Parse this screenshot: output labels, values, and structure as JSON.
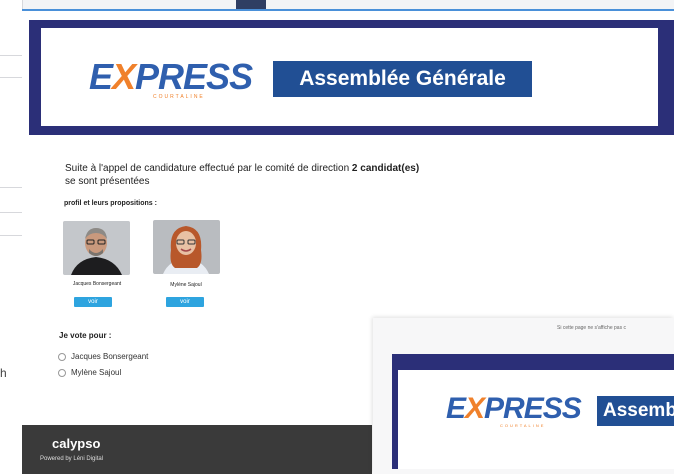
{
  "back_window": {
    "partial_label": "h"
  },
  "email": {
    "logo": {
      "word_pre": "E",
      "word_x": "X",
      "word_post": "PRESS",
      "tagline": "COURTALINE"
    },
    "banner_title": "Assemblée Générale",
    "intro_prefix": "Suite à l'appel de candidature effectué par le comité de direction ",
    "intro_count": "2 candidat(es)",
    "intro_suffix": "se sont présentées",
    "profiles_label": "profil et leurs propositions :",
    "candidates": [
      {
        "name": "Jacques Bonsergeant",
        "button": "voir"
      },
      {
        "name": "Mylène Sajoul",
        "button": "voir"
      }
    ],
    "vote_label": "Je vote pour :",
    "options": [
      "Jacques Bonsergeant",
      "Mylène Sajoul"
    ],
    "footer": {
      "brand": "calypso",
      "powered": "Powered by Léni Digital"
    }
  },
  "front_window": {
    "notice": "Si cette page ne s'affiche pas c",
    "logo": {
      "word_pre": "E",
      "word_x": "X",
      "word_post": "PRESS",
      "tagline": "COURTALINE"
    },
    "banner_title": "Assemb"
  },
  "colors": {
    "navy": "#2b2f78",
    "brand_blue": "#214f94",
    "accent_orange": "#f0812b",
    "button_blue": "#2ea4df"
  }
}
